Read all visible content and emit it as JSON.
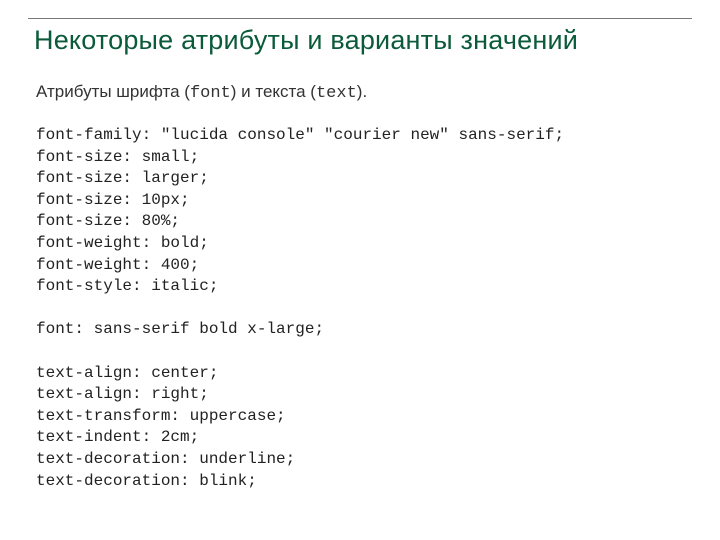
{
  "title": "Некоторые атрибуты и варианты значений",
  "intro": {
    "t1": "Атрибуты шрифта (",
    "font_kw": "font",
    "t2": ") и текста (",
    "text_kw": "text",
    "t3": ")."
  },
  "code": "font-family: \"lucida console\" \"courier new\" sans-serif;\nfont-size: small;\nfont-size: larger;\nfont-size: 10px;\nfont-size: 80%;\nfont-weight: bold;\nfont-weight: 400;\nfont-style: italic;\n\nfont: sans-serif bold x-large;\n\ntext-align: center;\ntext-align: right;\ntext-transform: uppercase;\ntext-indent: 2cm;\ntext-decoration: underline;\ntext-decoration: blink;"
}
